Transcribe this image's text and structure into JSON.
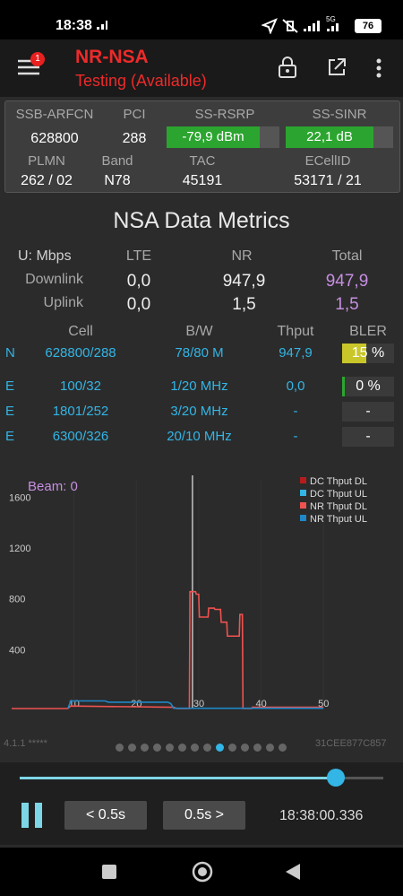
{
  "status": {
    "time": "18:38",
    "net": "5G",
    "battery": "76"
  },
  "app": {
    "title": "NR-NSA",
    "subtitle": "Testing (Available)",
    "badge": "1"
  },
  "info": {
    "headers1": [
      "SSB-ARFCN",
      "PCI",
      "SS-RSRP",
      "SS-SINR"
    ],
    "ssb_arfcn": "628800",
    "pci": "288",
    "rsrp": "-79,9 dBm",
    "sinr": "22,1 dB",
    "headers2": [
      "PLMN",
      "Band",
      "TAC",
      "ECellID"
    ],
    "plmn": "262 / 02",
    "band": "N78",
    "tac": "45191",
    "ecellid": "53171 / 21"
  },
  "metrics": {
    "title": "NSA Data Metrics",
    "unit": "U: Mbps",
    "col_lte": "LTE",
    "col_nr": "NR",
    "col_total": "Total",
    "downlink_label": "Downlink",
    "uplink_label": "Uplink",
    "dl_lte": "0,0",
    "dl_nr": "947,9",
    "dl_total": "947,9",
    "ul_lte": "0,0",
    "ul_nr": "1,5",
    "ul_total": "1,5"
  },
  "cells": {
    "headers": [
      "Cell",
      "B/W",
      "Thput",
      "BLER"
    ],
    "rows": [
      {
        "type": "N",
        "cell": "628800/288",
        "bw": "78/80 M",
        "thput": "947,9",
        "bler": "15 %",
        "bler_fill": 0.15
      },
      {
        "type": "E",
        "cell": "100/32",
        "bw": "1/20 MHz",
        "thput": "0,0",
        "bler": "0 %",
        "bler_fill": 0
      },
      {
        "type": "E",
        "cell": "1801/252",
        "bw": "3/20 MHz",
        "thput": "-",
        "bler": "-",
        "bler_fill": 0
      },
      {
        "type": "E",
        "cell": "6300/326",
        "bw": "20/10 MHz",
        "thput": "-",
        "bler": "-",
        "bler_fill": 0
      }
    ]
  },
  "chart_data": {
    "type": "line",
    "title": "",
    "annotation": "Beam: 0",
    "legend_position": "top-right",
    "xlim": [
      0,
      54
    ],
    "ylim": [
      0,
      1800
    ],
    "x_ticks": [
      10,
      20,
      30,
      40,
      50
    ],
    "y_ticks": [
      400,
      800,
      1200,
      1600
    ],
    "marker_x": 29,
    "series": [
      {
        "name": "DC Thput DL",
        "color": "#b71c1c",
        "x": [],
        "y": []
      },
      {
        "name": "DC Thput UL",
        "color": "#33b5e5",
        "x": [],
        "y": []
      },
      {
        "name": "NR Thput DL",
        "color": "#ef5350",
        "x": [
          0,
          1,
          1.1,
          9,
          9.5,
          26,
          26.5,
          28.5,
          28.6,
          29.5,
          29.6,
          30,
          30.1,
          31.5,
          31.6,
          32.5,
          32.6,
          33.5,
          33.6,
          34.5,
          34.6,
          36.5,
          36.6,
          37,
          37.1,
          38.5,
          38.6,
          50
        ],
        "y": [
          0,
          0,
          0,
          0,
          20,
          10,
          0,
          0,
          920,
          920,
          900,
          900,
          720,
          720,
          790,
          790,
          780,
          780,
          680,
          680,
          570,
          570,
          740,
          740,
          0,
          0,
          10,
          10
        ]
      },
      {
        "name": "NR Thput UL",
        "color": "#1e88c8",
        "x": [
          9,
          9.5,
          15,
          15.5,
          25,
          25.5,
          26,
          50
        ],
        "y": [
          0,
          60,
          60,
          50,
          50,
          40,
          2,
          2
        ]
      }
    ]
  },
  "footer": {
    "version": "4.1.1 *****",
    "id": "31CEE877C857",
    "page_count": 14,
    "page_active": 8
  },
  "controls": {
    "slider_value": 0.87,
    "back_label": "< 0.5s",
    "fwd_label": "0.5s >",
    "time": "18:38:00.336"
  }
}
